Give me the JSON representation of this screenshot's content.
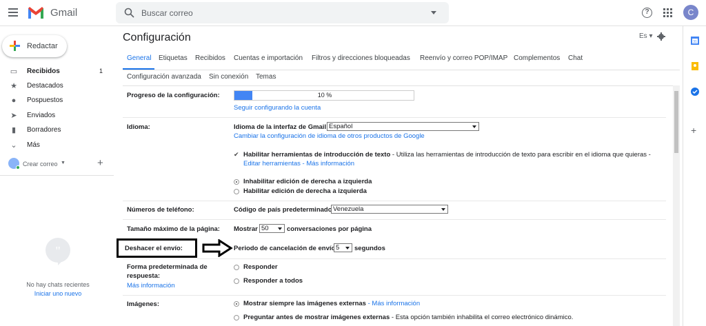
{
  "app": {
    "logo_text": "Gmail"
  },
  "search": {
    "placeholder": "Buscar correo"
  },
  "account": {
    "avatar_letter": "C"
  },
  "sidebar": {
    "compose_label": "Redactar",
    "items": [
      {
        "label": "Recibidos",
        "count": "1"
      },
      {
        "label": "Destacados"
      },
      {
        "label": "Pospuestos"
      },
      {
        "label": "Enviados"
      },
      {
        "label": "Borradores"
      },
      {
        "label": "Más"
      }
    ],
    "chat_user_label": "Crear correo",
    "no_chats": "No hay chats recientes",
    "start_chat": "Iniciar uno nuevo"
  },
  "settings": {
    "title": "Configuración",
    "lang_short": "Es",
    "tabs": [
      "General",
      "Etiquetas",
      "Recibidos",
      "Cuentas e importación",
      "Filtros y direcciones bloqueadas",
      "Reenvío y correo POP/IMAP",
      "Complementos",
      "Chat"
    ],
    "tabs_row2": [
      "Configuración avanzada",
      "Sin conexión",
      "Temas"
    ],
    "progress": {
      "label": "Progreso de la configuración:",
      "percent": 10,
      "text": "10 %",
      "link": "Seguir configurando la cuenta"
    },
    "language": {
      "label": "Idioma:",
      "ui_label": "Idioma de la interfaz de Gmail:",
      "ui_value": "Español",
      "change_link": "Cambiar la configuración de idioma de otros productos de Google",
      "input_tools_bold": "Habilitar herramientas de introducción de texto",
      "input_tools_desc": " - Utiliza las herramientas de introducción de texto para escribir en el idioma que quieras -",
      "edit_tools_link": "Editar herramientas",
      "sep": " - ",
      "more_info_link": "Más información",
      "rtl_off": "Inhabilitar edición de derecha a izquierda",
      "rtl_on": "Habilitar edición de derecha a izquierda"
    },
    "phone": {
      "label": "Números de teléfono:",
      "country_label": "Código de país predeterminado:",
      "country_value": "Venezuela"
    },
    "page_size": {
      "label": "Tamaño máximo de la página:",
      "show": "Mostrar",
      "value": "50",
      "suffix": "conversaciones por página"
    },
    "undo_send": {
      "label": "Deshacer el envío:",
      "period_label": "Periodo de cancelación de envío:",
      "value": "5",
      "suffix": "segundos"
    },
    "reply_default": {
      "label": "Forma predeterminada de respuesta:",
      "more_info": "Más información",
      "reply": "Responder",
      "reply_all": "Responder a todos"
    },
    "images": {
      "label": "Imágenes:",
      "always_show": "Mostrar siempre las imágenes externas",
      "sep": " - ",
      "more_info": "Más información",
      "ask_bold": "Preguntar antes de mostrar imágenes externas",
      "ask_desc": " - Esta opción también inhabilita el correo electrónico dinámico."
    }
  },
  "colors": {
    "accent": "#1a73e8",
    "progress": "#4285f4"
  }
}
